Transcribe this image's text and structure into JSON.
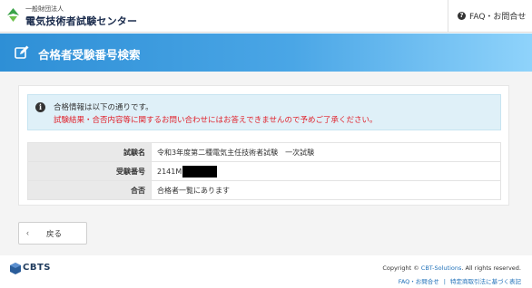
{
  "header": {
    "org_sub": "一般財団法人",
    "org_main": "電気技術者試験センター",
    "faq_label": "FAQ・お問合せ",
    "help_icon": "question-circle-icon"
  },
  "title_bar": {
    "title": "合格者受験番号検索",
    "icon": "edit-icon"
  },
  "alert": {
    "icon": "info-circle-icon",
    "line1": "合格情報は以下の通りです。",
    "line2": "試験結果・合否内容等に関するお問い合わせにはお答えできませんので予めご了承ください。",
    "line2_color": "#e0202a"
  },
  "result": {
    "rows": [
      {
        "label": "試験名",
        "value": "令和3年度第二種電気主任技術者試験　一次試験"
      },
      {
        "label": "受験番号",
        "value": "2141M"
      },
      {
        "label": "合否",
        "value": "合格者一覧にあります"
      }
    ]
  },
  "back_button": {
    "label": "戻る",
    "icon": "chevron-left-icon"
  },
  "footer": {
    "logo_text": "CBTS",
    "copyright_prefix": "Copyright © ",
    "copyright_link": "CBT-Solutions",
    "copyright_suffix": ". All rights reserved.",
    "link_faq": "FAQ・お問合せ",
    "link_legal": "特定商取引法に基づく表記"
  },
  "colors": {
    "title_bar_start": "#2e8fd6",
    "title_bar_end": "#8fd3fb",
    "link": "#1d6fb8"
  }
}
